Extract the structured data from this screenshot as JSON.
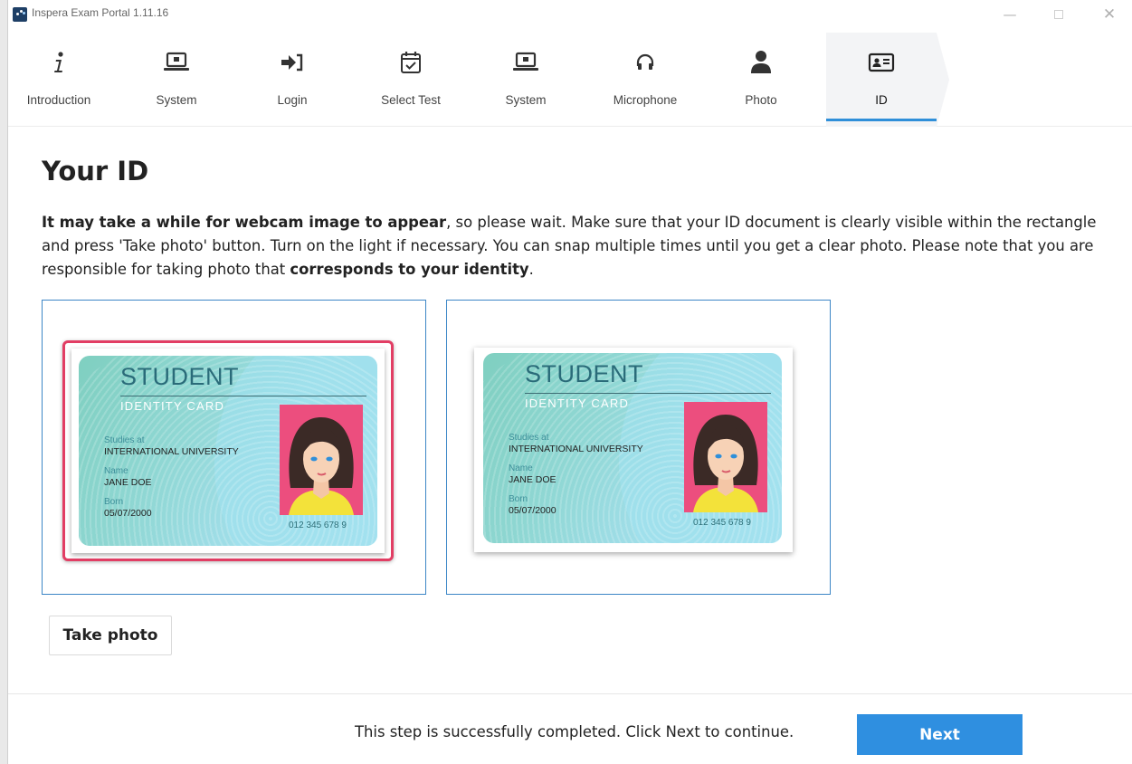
{
  "window": {
    "title": "Inspera Exam Portal 1.11.16"
  },
  "steps": [
    {
      "label": "Introduction",
      "icon": "info-icon"
    },
    {
      "label": "System",
      "icon": "laptop-icon"
    },
    {
      "label": "Login",
      "icon": "login-arrow-icon"
    },
    {
      "label": "Select Test",
      "icon": "calendar-check-icon"
    },
    {
      "label": "System",
      "icon": "laptop-icon"
    },
    {
      "label": "Microphone",
      "icon": "headset-icon"
    },
    {
      "label": "Photo",
      "icon": "user-icon"
    },
    {
      "label": "ID",
      "icon": "id-card-icon",
      "active": true
    }
  ],
  "main": {
    "heading": "Your ID",
    "desc_bold1": "It may take a while for webcam image to appear",
    "desc_text1": ", so please wait. Make sure that your ID document is clearly visible within the rectangle and press 'Take photo' button. Turn on the light if necessary. You can snap multiple times until you get a clear photo. Please note that you are responsible for taking photo that ",
    "desc_bold2": "corresponds to your identity",
    "desc_text2": "."
  },
  "card": {
    "title": "STUDENT",
    "subtitle": "IDENTITY CARD",
    "studies_label": "Studies at",
    "studies_value": "INTERNATIONAL UNIVERSITY",
    "name_label": "Name",
    "name_value": "JANE DOE",
    "born_label": "Born",
    "born_value": "05/07/2000",
    "number": "012 345 678 9"
  },
  "actions": {
    "take_photo": "Take photo",
    "next": "Next"
  },
  "footer": {
    "message": "This step is successfully completed. Click Next to continue."
  },
  "colors": {
    "accent": "#2f8fe0",
    "highlight_frame": "#e23e64",
    "panel_border": "#3c86c6"
  }
}
